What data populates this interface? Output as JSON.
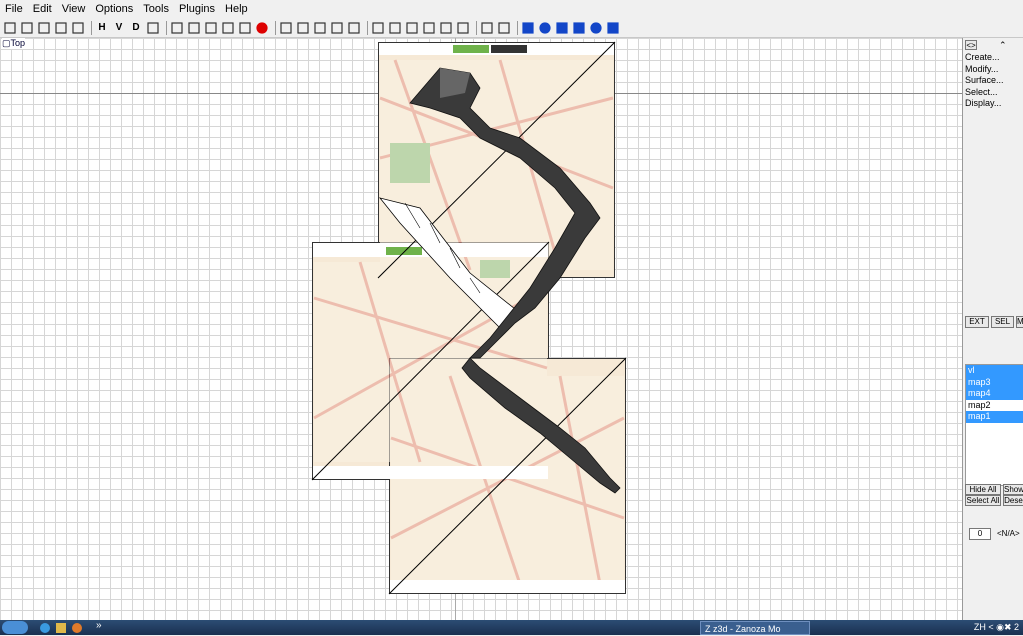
{
  "menu": [
    "File",
    "Edit",
    "View",
    "Options",
    "Tools",
    "Plugins",
    "Help"
  ],
  "toolbar_icons": [
    "new-file-icon",
    "open-folder-icon",
    "save-icon",
    "save-as-icon",
    "print-icon",
    "H",
    "V",
    "D",
    "snap-icon",
    "select-icon",
    "view-top-icon",
    "view-front-icon",
    "view-side-icon",
    "view-persp-icon",
    "render-sphere-icon",
    "zoom-icon",
    "pan-hand-icon",
    "zoom-box-icon",
    "zoom-extents-icon",
    "zoom-all-icon",
    "vertex-icon",
    "edge-icon",
    "face-icon",
    "object-icon",
    "grid-icon",
    "measure-icon",
    "rect-select-icon",
    "lasso-icon",
    "box-prim-icon",
    "sphere-prim-icon",
    "cylinder-prim-icon",
    "cone-prim-icon",
    "torus-prim-icon",
    "teapot-prim-icon"
  ],
  "viewport": {
    "label": "Top"
  },
  "side": {
    "commands": [
      "Create...",
      "Modify...",
      "Surface...",
      "Select...",
      "Display..."
    ],
    "ext": "EXT",
    "sel": "SEL",
    "m": "M",
    "layers": [
      {
        "name": "vl",
        "selected": true
      },
      {
        "name": "map3",
        "selected": true
      },
      {
        "name": "map4",
        "selected": true
      },
      {
        "name": "map2",
        "selected": false
      },
      {
        "name": "map1",
        "selected": true
      }
    ],
    "hide_all": "Hide All",
    "show": "Show",
    "select_all": "Select All",
    "desel": "Dese",
    "spinner": "0",
    "na": "<N/A>"
  },
  "taskbar": {
    "task": "Z z3d - Zanoza Mo",
    "lang": "ZH"
  }
}
